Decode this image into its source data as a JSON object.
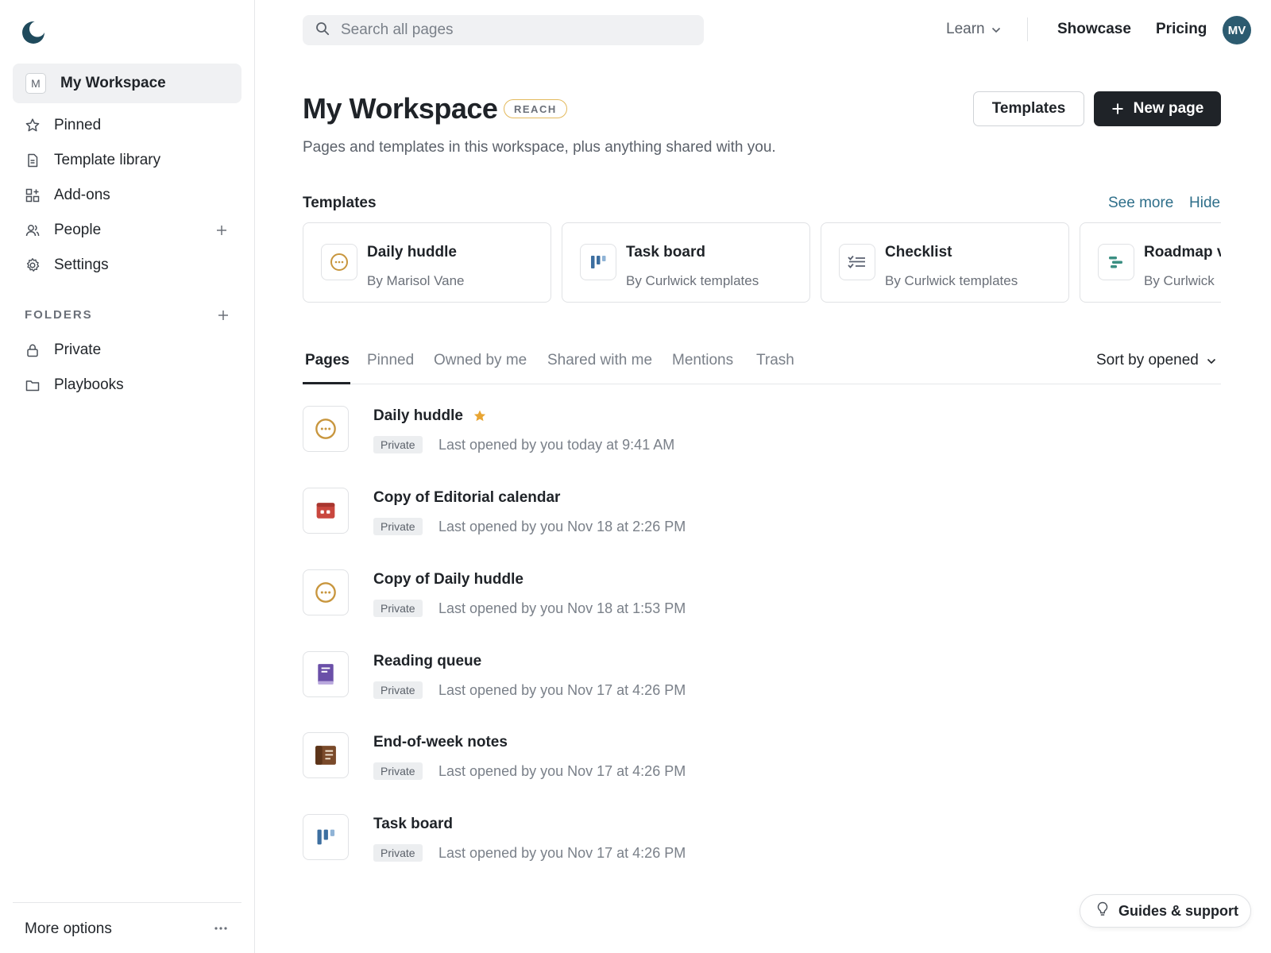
{
  "sidebar": {
    "workspace": {
      "initial": "M",
      "name": "My Workspace"
    },
    "nav": [
      {
        "label": "Pinned"
      },
      {
        "label": "Template library"
      },
      {
        "label": "Add-ons"
      },
      {
        "label": "People"
      },
      {
        "label": "Settings"
      }
    ],
    "folders_header": "FOLDERS",
    "folders": [
      {
        "label": "Private"
      },
      {
        "label": "Playbooks"
      }
    ],
    "more_options": "More options"
  },
  "topbar": {
    "search_placeholder": "Search all pages",
    "learn": "Learn",
    "showcase": "Showcase",
    "pricing": "Pricing",
    "user_initials": "MV"
  },
  "header": {
    "title": "My Workspace",
    "plan_badge": "REACH",
    "subtitle": "Pages and templates in this workspace, plus anything shared with you.",
    "templates_button": "Templates",
    "new_page_button": "New page"
  },
  "templates": {
    "heading": "Templates",
    "see_more": "See more",
    "hide": "Hide",
    "cards": [
      {
        "name": "Daily huddle",
        "by": "By Marisol Vane",
        "icon": "huddle-icon"
      },
      {
        "name": "Task board",
        "by": "By Curlwick templates",
        "icon": "board-icon"
      },
      {
        "name": "Checklist",
        "by": "By Curlwick templates",
        "icon": "checklist-icon"
      },
      {
        "name": "Roadmap v",
        "by": "By Curlwick",
        "icon": "roadmap-icon"
      }
    ]
  },
  "tabs": [
    {
      "label": "Pages",
      "active": true
    },
    {
      "label": "Pinned"
    },
    {
      "label": "Owned by me"
    },
    {
      "label": "Shared with me"
    },
    {
      "label": "Mentions"
    },
    {
      "label": "Trash"
    }
  ],
  "sort_label": "Sort by opened",
  "pages": [
    {
      "title": "Daily huddle",
      "starred": true,
      "tag": "Private",
      "meta": "Last opened by you today at 9:41 AM",
      "icon": "huddle-icon"
    },
    {
      "title": "Copy of Editorial calendar",
      "tag": "Private",
      "meta": "Last opened by you Nov 18 at 2:26 PM",
      "icon": "calendar-icon"
    },
    {
      "title": "Copy of Daily huddle",
      "tag": "Private",
      "meta": "Last opened by you Nov 18 at 1:53 PM",
      "icon": "huddle-icon"
    },
    {
      "title": "Reading queue",
      "tag": "Private",
      "meta": "Last opened by you Nov 17 at 4:26 PM",
      "icon": "book-icon"
    },
    {
      "title": "End-of-week notes",
      "tag": "Private",
      "meta": "Last opened by you Nov 17 at 4:26 PM",
      "icon": "notes-icon"
    },
    {
      "title": "Task board",
      "tag": "Private",
      "meta": "Last opened by you Nov 17 at 4:26 PM",
      "icon": "board-icon"
    }
  ],
  "guides_label": "Guides & support",
  "colors": {
    "accent_link": "#2f6f8a",
    "avatar_bg": "#2c5b70",
    "primary_button": "#1f2328",
    "badge_border": "#e3b95c",
    "star": "#e8a533"
  }
}
